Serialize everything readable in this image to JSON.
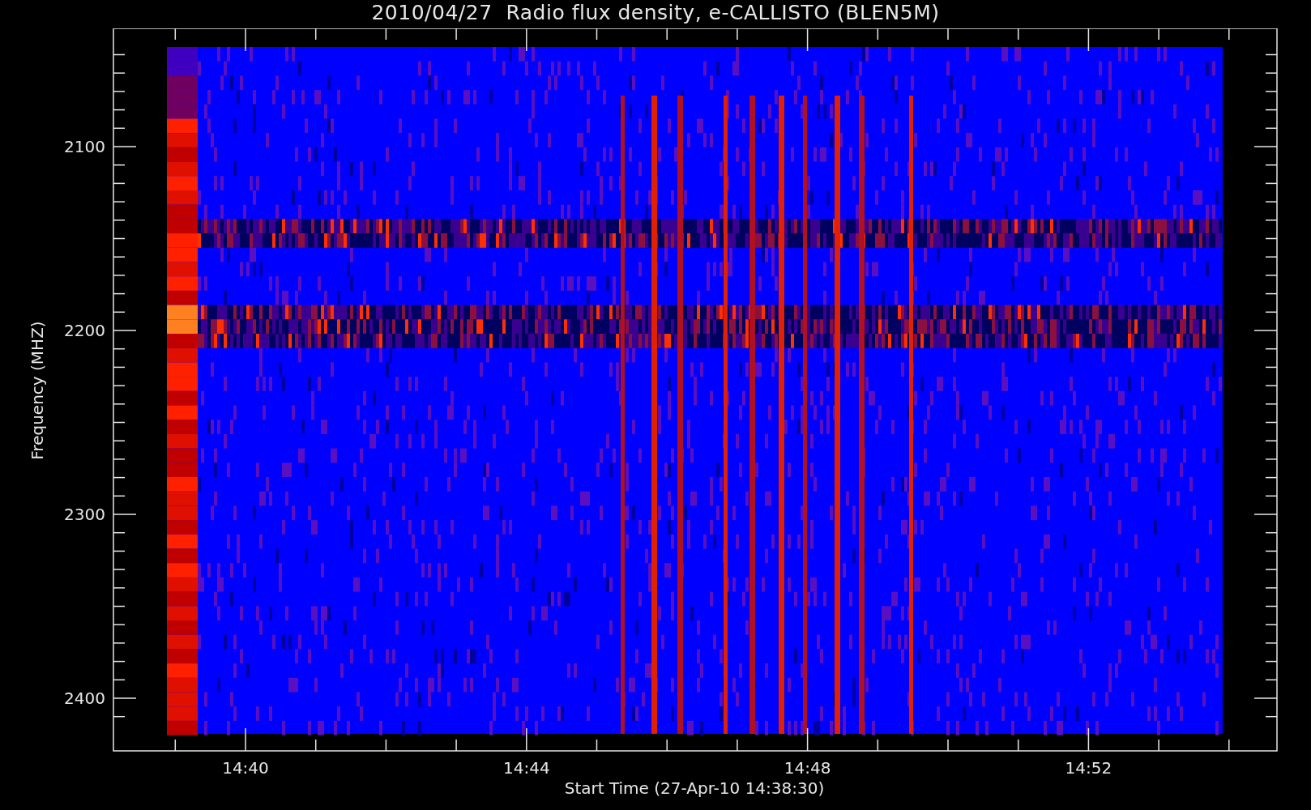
{
  "title": "2010/04/27  Radio flux density, e-CALLISTO (BLEN5M)",
  "y_axis": {
    "label": "Frequency (MHZ)",
    "ticks": [
      "2100",
      "2200",
      "2300",
      "2400"
    ]
  },
  "x_axis": {
    "label": "Start Time (27-Apr-10 14:38:30)",
    "ticks": [
      "14:40",
      "14:44",
      "14:48",
      "14:52"
    ]
  }
}
